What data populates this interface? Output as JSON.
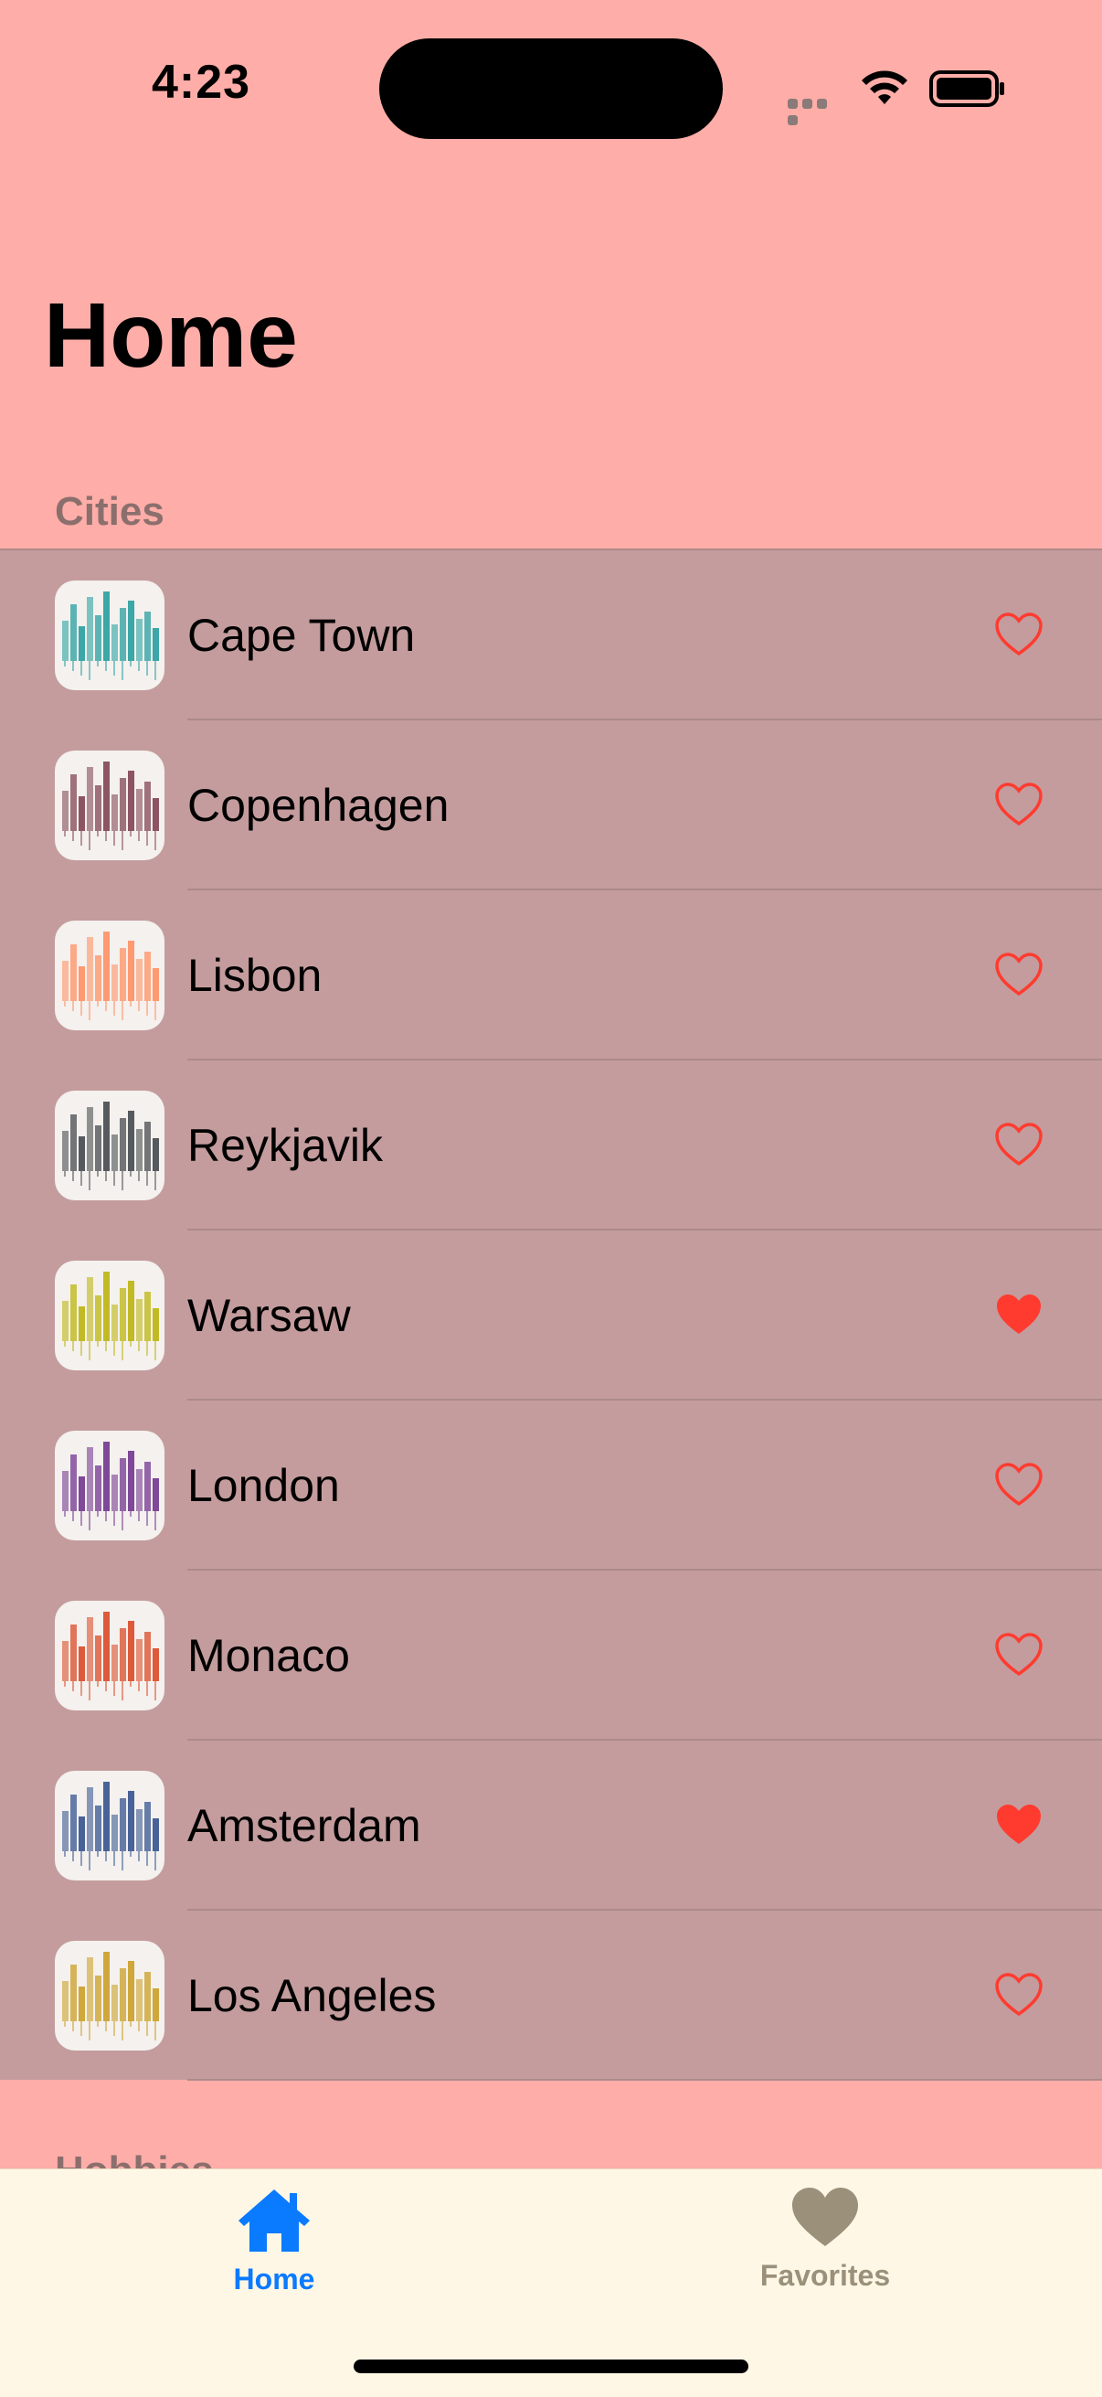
{
  "status_bar": {
    "time": "4:23"
  },
  "header": {
    "title": "Home"
  },
  "sections": {
    "cities_label": "Cities",
    "hobbies_label": "Hobbies"
  },
  "colors": {
    "background": "#FFADA8",
    "list_background": "#C49C9D",
    "heart": "#FF3B30",
    "tab_active": "#0A7AFF",
    "tab_inactive": "#9B9079",
    "tab_bar": "#FEF7E6"
  },
  "cities": [
    {
      "name": "Cape Town",
      "favorite": false,
      "thumb_color": "#1a9a9a",
      "icon": "cape-town-skyline-thumbnail"
    },
    {
      "name": "Copenhagen",
      "favorite": false,
      "thumb_color": "#7a3a4a",
      "icon": "copenhagen-skyline-thumbnail"
    },
    {
      "name": "Lisbon",
      "favorite": false,
      "thumb_color": "#ff8a5a",
      "icon": "lisbon-skyline-thumbnail"
    },
    {
      "name": "Reykjavik",
      "favorite": false,
      "thumb_color": "#3a3f44",
      "icon": "reykjavik-skyline-thumbnail"
    },
    {
      "name": "Warsaw",
      "favorite": true,
      "thumb_color": "#b8b000",
      "icon": "warsaw-skyline-thumbnail"
    },
    {
      "name": "London",
      "favorite": false,
      "thumb_color": "#6a2a8a",
      "icon": "london-skyline-thumbnail"
    },
    {
      "name": "Monaco",
      "favorite": false,
      "thumb_color": "#d8401a",
      "icon": "monaco-skyline-thumbnail"
    },
    {
      "name": "Amsterdam",
      "favorite": true,
      "thumb_color": "#2a4a8a",
      "icon": "amsterdam-skyline-thumbnail"
    },
    {
      "name": "Los Angeles",
      "favorite": false,
      "thumb_color": "#c89a1a",
      "icon": "los-angeles-skyline-thumbnail"
    }
  ],
  "tab_bar": {
    "home_label": "Home",
    "favorites_label": "Favorites",
    "selected": "home"
  }
}
